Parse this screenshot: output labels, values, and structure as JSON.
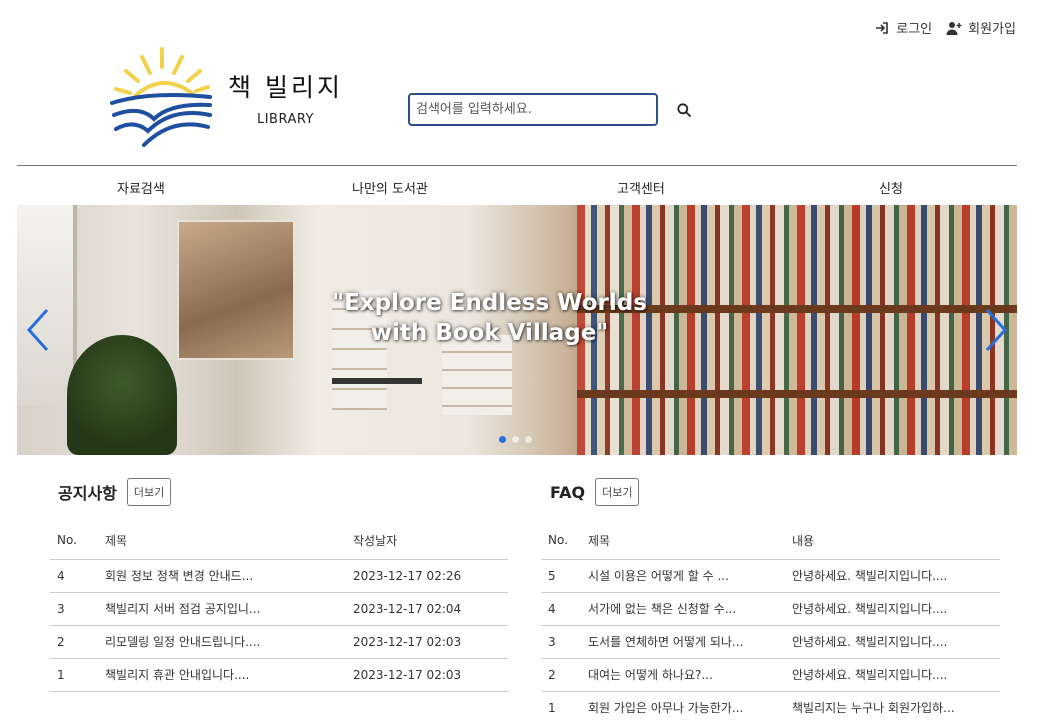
{
  "header": {
    "login_label": "로그인",
    "signup_label": "회원가입",
    "logo_title": "책 빌리지",
    "logo_subtitle": "LIBRARY"
  },
  "search": {
    "placeholder": "검색어를 입력하세요."
  },
  "nav": {
    "items": [
      "자료검색",
      "나만의 도서관",
      "고객센터",
      "신청"
    ]
  },
  "banner": {
    "caption_line1": "\"Explore Endless Worlds",
    "caption_line2": "with Book Village\"",
    "slide_count": 3,
    "active_slide": 1
  },
  "notice": {
    "title": "공지사항",
    "more_label": "더보기",
    "columns": [
      "No.",
      "제목",
      "작성날자"
    ],
    "rows": [
      [
        "4",
        "회원 정보 정책 변경 안내드...",
        "2023-12-17 02:26"
      ],
      [
        "3",
        "책빌리지 서버 점검 공지입니...",
        "2023-12-17 02:04"
      ],
      [
        "2",
        "리모델링 일정 안내드립니다....",
        "2023-12-17 02:03"
      ],
      [
        "1",
        "책빌리지 휴관 안내입니다....",
        "2023-12-17 02:03"
      ]
    ]
  },
  "faq": {
    "title": "FAQ",
    "more_label": "더보기",
    "columns": [
      "No.",
      "제목",
      "내용"
    ],
    "rows": [
      [
        "5",
        "시설 이용은 어떻게 할 수 ...",
        "안녕하세요. 책빌리지입니다...."
      ],
      [
        "4",
        "서가에 없는 책은 신청할 수...",
        "안녕하세요. 책빌리지입니다...."
      ],
      [
        "3",
        "도서를 연체하면 어떻게 되나...",
        "안녕하세요. 책빌리지입니다...."
      ],
      [
        "2",
        "대여는 어떻게 하나요?...",
        "안녕하세요. 책빌리지입니다...."
      ],
      [
        "1",
        "회원 가입은 아무나 가능한가...",
        "책빌리지는 누구나 회원가입하..."
      ]
    ]
  },
  "colors": {
    "accent_blue": "#2b4f8a",
    "logo_yellow": "#f2d24a",
    "logo_blue": "#1f4fa0",
    "carousel_arrow": "#2a6fdb"
  }
}
